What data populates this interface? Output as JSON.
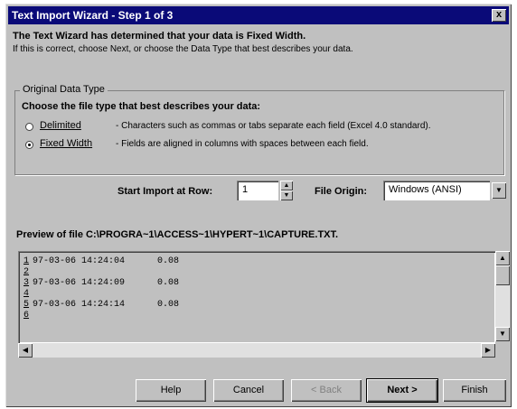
{
  "window": {
    "title": "Text Import Wizard - Step 1 of 3",
    "close_glyph": "x"
  },
  "intro": {
    "line1": "The Text Wizard has determined that your data is Fixed Width.",
    "line2": "If this is correct, choose Next, or choose the Data Type that best describes your data."
  },
  "original_data_type": {
    "group_label": "Original Data Type",
    "prompt": "Choose the file type that best describes your data:",
    "options": [
      {
        "label": "Delimited",
        "description": "- Characters such as commas or tabs separate each field (Excel 4.0 standard).",
        "selected": false
      },
      {
        "label": "Fixed Width",
        "description": "- Fields are aligned in columns with spaces between each field.",
        "selected": true
      }
    ]
  },
  "start_import": {
    "label": "Start Import at Row:",
    "value": "1"
  },
  "file_origin": {
    "label": "File Origin:",
    "value": "Windows (ANSI)"
  },
  "preview": {
    "label": "Preview of file C:\\PROGRA~1\\ACCESS~1\\HYPERT~1\\CAPTURE.TXT.",
    "rows": [
      {
        "num": "1",
        "text": "97-03-06 14:24:04      0.08"
      },
      {
        "num": "2",
        "text": ""
      },
      {
        "num": "3",
        "text": "97-03-06 14:24:09      0.08"
      },
      {
        "num": "4",
        "text": ""
      },
      {
        "num": "5",
        "text": "97-03-06 14:24:14      0.08"
      },
      {
        "num": "6",
        "text": ""
      }
    ]
  },
  "buttons": {
    "help": "Help",
    "cancel": "Cancel",
    "back": "< Back",
    "next": "Next >",
    "finish": "Finish"
  },
  "colors": {
    "titlebar": "#0a0a78",
    "face": "#c0c0c0"
  }
}
